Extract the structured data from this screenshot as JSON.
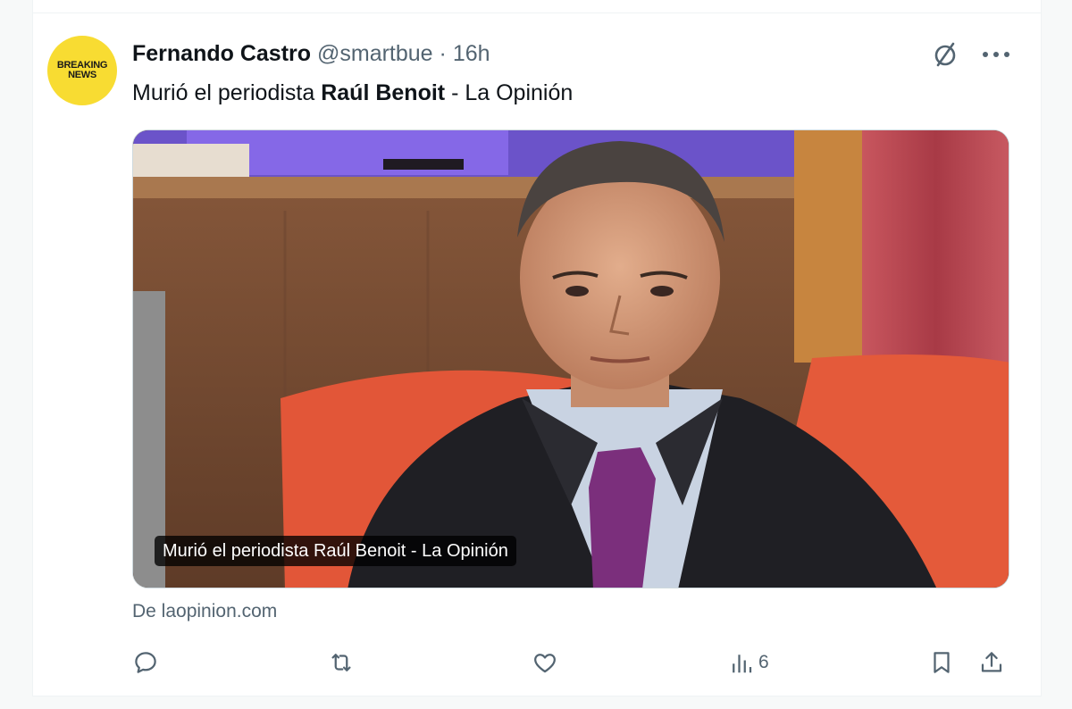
{
  "tweet": {
    "avatar": {
      "line1": "BREAKING",
      "line2": "NEWS"
    },
    "author_name": "Fernando Castro",
    "handle": "@smartbue",
    "separator": "·",
    "time": "16h",
    "text_before": "Murió el periodista ",
    "text_bold": "Raúl Benoit",
    "text_after": " - La Opinión",
    "card": {
      "caption": "Murió el periodista Raúl Benoit - La Opinión",
      "source": "De laopinion.com"
    },
    "actions": {
      "reply_icon": "speech-bubble-icon",
      "retweet_icon": "retweet-icon",
      "like_icon": "heart-icon",
      "views_icon": "bar-chart-icon",
      "views_count": "6",
      "bookmark_icon": "bookmark-icon",
      "share_icon": "share-upload-icon"
    }
  },
  "colors": {
    "text_primary": "#0f1419",
    "text_muted": "#536471",
    "avatar_bg": "#f8dc32",
    "divider": "#eff3f4"
  }
}
